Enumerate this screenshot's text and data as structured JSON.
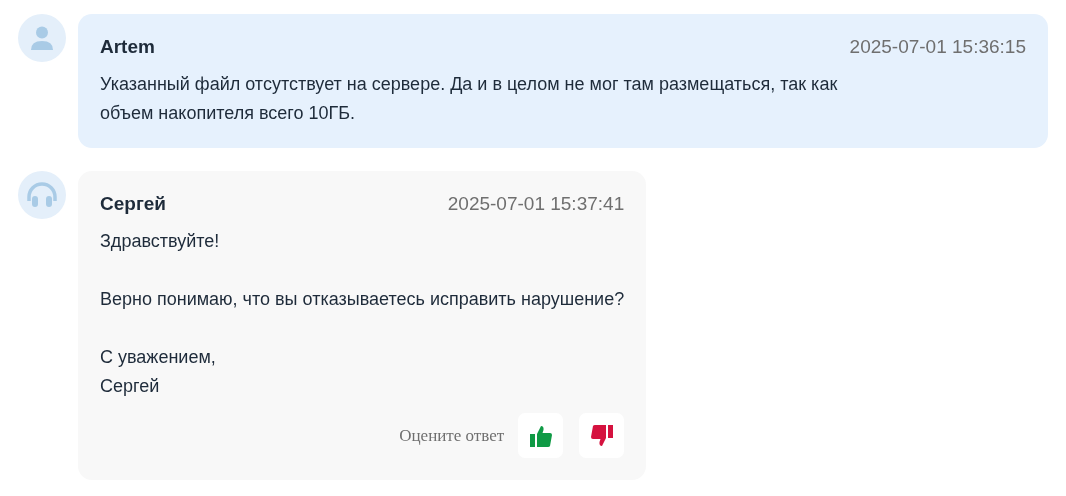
{
  "messages": [
    {
      "kind": "user",
      "author": "Artem",
      "time": "2025-07-01 15:36:15",
      "text": "Указанный файл отсутствует на сервере. Да и в целом не мог там размещаться, так как\nобъем накопителя всего 10ГБ."
    },
    {
      "kind": "operator",
      "author": "Сергей",
      "time": "2025-07-01 15:37:41",
      "text": "Здравствуйте!\n\nВерно понимаю, что вы отказываетесь исправить нарушение?\n\nС уважением,\nСергей",
      "rating": {
        "label": "Оцените ответ"
      }
    }
  ]
}
